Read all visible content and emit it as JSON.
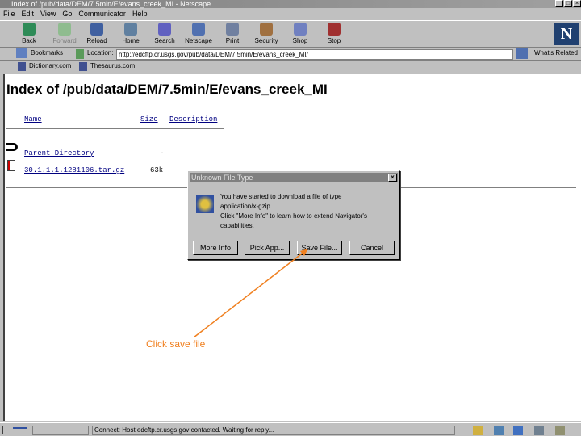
{
  "window": {
    "title": "Index of /pub/data/DEM/7.5min/E/evans_creek_MI - Netscape"
  },
  "menu": [
    "File",
    "Edit",
    "View",
    "Go",
    "Communicator",
    "Help"
  ],
  "toolbar": [
    {
      "label": "Back",
      "icon": "back-arrow-icon",
      "color": "#2e8b57"
    },
    {
      "label": "Forward",
      "icon": "forward-arrow-icon",
      "color": "#8fbc8f"
    },
    {
      "label": "Reload",
      "icon": "reload-icon",
      "color": "#4060a0"
    },
    {
      "label": "Home",
      "icon": "home-icon",
      "color": "#6080a0"
    },
    {
      "label": "Search",
      "icon": "search-icon",
      "color": "#6060c0"
    },
    {
      "label": "Netscape",
      "icon": "netscape-icon",
      "color": "#5070b0"
    },
    {
      "label": "Print",
      "icon": "print-icon",
      "color": "#7080a0"
    },
    {
      "label": "Security",
      "icon": "lock-icon",
      "color": "#a07040"
    },
    {
      "label": "Shop",
      "icon": "shop-icon",
      "color": "#7080c0"
    },
    {
      "label": "Stop",
      "icon": "stop-icon",
      "color": "#a03030"
    }
  ],
  "location": {
    "bookmarks": "Bookmarks",
    "label": "Location:",
    "url": "http://edcftp.cr.usgs.gov/pub/data/DEM/7.5min/E/evans_creek_MI/",
    "related": "What's Related"
  },
  "personal": [
    "Dictionary.com",
    "Thesaurus.com"
  ],
  "page": {
    "title": "Index of /pub/data/DEM/7.5min/E/evans_creek_MI",
    "headers": {
      "name": "Name",
      "size": "Size",
      "description": "Description"
    },
    "rows": [
      {
        "name": "Parent Directory",
        "size": "-"
      },
      {
        "name": "30.1.1.1.1281106.tar.gz",
        "size": "63k"
      }
    ]
  },
  "dialog": {
    "title": "Unknown File Type",
    "message_lines": [
      "You have started to download a file of type",
      "application/x-gzip",
      "Click \"More Info\" to learn how to extend Navigator's",
      "capabilities."
    ],
    "buttons": [
      "More Info",
      "Pick App...",
      "Save File...",
      "Cancel"
    ]
  },
  "annotation": {
    "text": "Click save file",
    "color": "#f08020"
  },
  "status": {
    "text": "Connect: Host edcftp.cr.usgs.gov contacted. Waiting for reply..."
  }
}
